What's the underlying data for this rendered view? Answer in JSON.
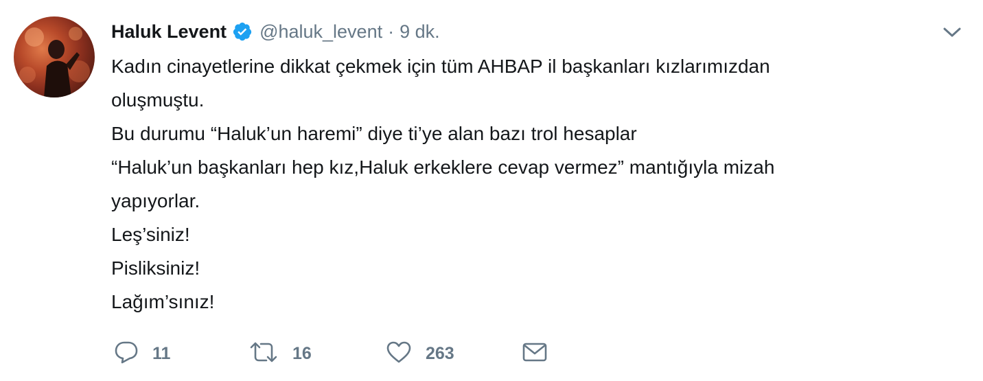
{
  "tweet": {
    "author_name": "Haluk Levent",
    "handle": "@haluk_levent",
    "separator": "·",
    "time": "9 dk.",
    "lines": [
      "Kadın cinayetlerine dikkat çekmek için tüm AHBAP il başkanları kızlarımızdan",
      "oluşmuştu.",
      "Bu durumu “Haluk’un haremi” diye ti’ye alan bazı trol hesaplar",
      "“Haluk’un başkanları hep kız,Haluk erkeklere cevap vermez” mantığıyla mizah",
      "yapıyorlar.",
      "Leş’siniz!",
      "Pisliksiniz!",
      "Lağım’sınız!"
    ],
    "actions": {
      "replies": "11",
      "retweets": "16",
      "likes": "263"
    }
  },
  "colors": {
    "verified": "#1da1f2",
    "secondary_text": "#657786",
    "primary_text": "#14171a"
  },
  "icons": [
    "verified-badge-icon",
    "chevron-down-icon",
    "reply-icon",
    "retweet-icon",
    "like-icon",
    "direct-message-icon"
  ]
}
